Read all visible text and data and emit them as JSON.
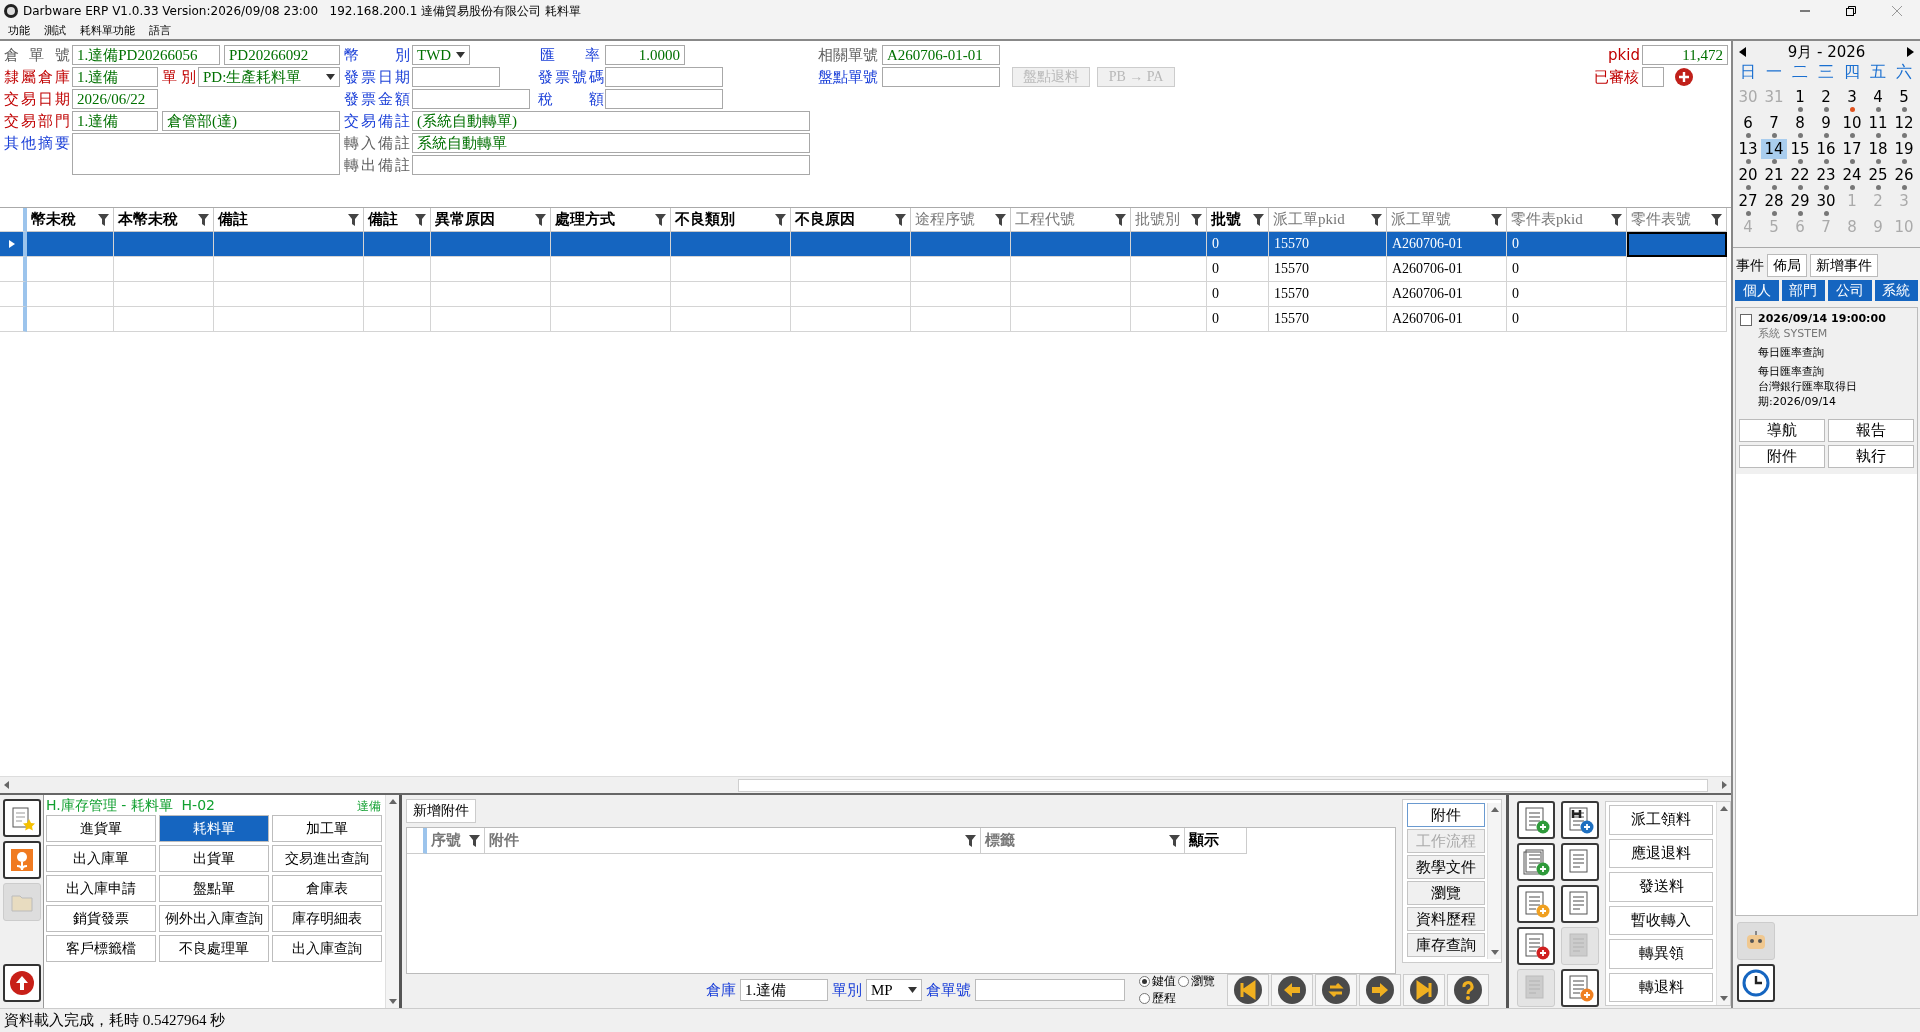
{
  "window": {
    "title": "Darbware ERP V1.0.33 Version:2026/09/08 23:00   192.168.200.1 達備貿易股份有限公司 耗料單"
  },
  "menu": [
    {
      "label": "功能"
    },
    {
      "label": "測試"
    },
    {
      "label": "耗料單功能"
    },
    {
      "label": "語言"
    }
  ],
  "form": {
    "items": [
      {
        "kind": "label",
        "text": "倉 單 號",
        "color": "#606060"
      },
      {
        "kind": "field",
        "value": "1.達備PD20266056"
      },
      {
        "kind": "field",
        "value": "PD20266092"
      },
      {
        "kind": "label",
        "text": "幣 別",
        "color": "#1a3fd8"
      },
      {
        "kind": "dropdown",
        "value": "TWD"
      },
      {
        "kind": "label",
        "text": "匯 率",
        "color": "#1a3fd8"
      },
      {
        "kind": "number",
        "value": "1.0000"
      },
      {
        "kind": "label",
        "text": "相關單號",
        "color": "#606060"
      },
      {
        "kind": "field",
        "value": "A260706-01-01"
      },
      {
        "kind": "label",
        "text": "pkid",
        "color": "#c00000"
      },
      {
        "kind": "number",
        "value": "11,472"
      },
      {
        "kind": "label",
        "text": "隸屬倉庫",
        "color": "#c00000"
      },
      {
        "kind": "field",
        "value": "1.達備"
      },
      {
        "kind": "label",
        "text": "單別",
        "color": "#c00000"
      },
      {
        "kind": "dropdown",
        "value": "PD:生產耗料單"
      },
      {
        "kind": "label",
        "text": "發票日期",
        "color": "#1a3fd8"
      },
      {
        "kind": "field"
      },
      {
        "kind": "label",
        "text": "發票號碼",
        "color": "#1a3fd8"
      },
      {
        "kind": "field"
      },
      {
        "kind": "label",
        "text": "盤點單號",
        "color": "#1a3fd8"
      },
      {
        "kind": "field"
      },
      {
        "kind": "button",
        "text": "盤點退料",
        "disabled": true
      },
      {
        "kind": "button",
        "text": "PB → PA",
        "disabled": true
      },
      {
        "kind": "label",
        "text": "已審核",
        "color": "#c00000"
      },
      {
        "kind": "checkbox",
        "checked": false
      },
      {
        "kind": "add"
      },
      {
        "kind": "label",
        "text": "交易日期",
        "color": "#c00000"
      },
      {
        "kind": "field",
        "value": "2026/06/22"
      },
      {
        "kind": "label",
        "text": "發票金額",
        "color": "#1a3fd8"
      },
      {
        "kind": "field"
      },
      {
        "kind": "label",
        "text": "稅 額",
        "color": "#1a3fd8"
      },
      {
        "kind": "field"
      },
      {
        "kind": "label",
        "text": "交易部門",
        "color": "#c00000"
      },
      {
        "kind": "field",
        "value": "1.達備"
      },
      {
        "kind": "field",
        "value": "倉管部(達)"
      },
      {
        "kind": "label",
        "text": "交易備註",
        "color": "#1a3fd8"
      },
      {
        "kind": "field",
        "value": "(系統自動轉單)"
      },
      {
        "kind": "label",
        "text": "其他摘要",
        "color": "#1a3fd8"
      },
      {
        "kind": "textarea"
      },
      {
        "kind": "label",
        "text": "轉入備註",
        "color": "#606060"
      },
      {
        "kind": "field",
        "value": "系統自動轉單"
      },
      {
        "kind": "label",
        "text": "轉出備註",
        "color": "#606060"
      },
      {
        "kind": "field"
      }
    ]
  },
  "table": {
    "columns": [
      {
        "header": "幣未稅",
        "readonly": false
      },
      {
        "header": "本幣未稅",
        "readonly": false
      },
      {
        "header": "備註",
        "readonly": false
      },
      {
        "header": "備註",
        "readonly": false
      },
      {
        "header": "異常原因",
        "readonly": false
      },
      {
        "header": "處理方式",
        "readonly": false
      },
      {
        "header": "不良類別",
        "readonly": false
      },
      {
        "header": "不良原因",
        "readonly": false
      },
      {
        "header": "途程序號",
        "readonly": true
      },
      {
        "header": "工程代號",
        "readonly": true
      },
      {
        "header": "批號別",
        "readonly": true
      },
      {
        "header": "批號",
        "readonly": false
      },
      {
        "header": "派工單pkid",
        "readonly": true
      },
      {
        "header": "派工單號",
        "readonly": true
      },
      {
        "header": "零件表pkid",
        "readonly": true
      },
      {
        "header": "零件表號",
        "readonly": true
      }
    ],
    "rows": [
      {
        "selected": true,
        "lot": "0",
        "dispatch_pkid": "15570",
        "dispatch_no": "A260706-01",
        "parts_pkid": "0"
      },
      {
        "selected": false,
        "lot": "0",
        "dispatch_pkid": "15570",
        "dispatch_no": "A260706-01",
        "parts_pkid": "0"
      },
      {
        "selected": false,
        "lot": "0",
        "dispatch_pkid": "15570",
        "dispatch_no": "A260706-01",
        "parts_pkid": "0"
      },
      {
        "selected": false,
        "lot": "0",
        "dispatch_pkid": "15570",
        "dispatch_no": "A260706-01",
        "parts_pkid": "0"
      }
    ]
  },
  "side_icons": [
    {
      "disabled": false
    },
    {
      "disabled": false
    },
    {
      "disabled": true
    },
    {
      "disabled": false
    }
  ],
  "module": {
    "title": "H.庫存管理 - 耗料單  H-02",
    "company": "達備",
    "buttons": [
      {
        "label": "進貨單",
        "selected": false
      },
      {
        "label": "耗料單",
        "selected": true
      },
      {
        "label": "加工單",
        "selected": false
      },
      {
        "label": "出入庫單",
        "selected": false
      },
      {
        "label": "出貨單",
        "selected": false
      },
      {
        "label": "交易進出查詢",
        "selected": false
      },
      {
        "label": "出入庫申請",
        "selected": false
      },
      {
        "label": "盤點單",
        "selected": false
      },
      {
        "label": "倉庫表",
        "selected": false
      },
      {
        "label": "銷貨發票",
        "selected": false
      },
      {
        "label": "例外出入庫查詢",
        "selected": false
      },
      {
        "label": "庫存明細表",
        "selected": false
      },
      {
        "label": "客戶標籤檔",
        "selected": false
      },
      {
        "label": "不良處理單",
        "selected": false
      },
      {
        "label": "出入庫查詢",
        "selected": false
      }
    ]
  },
  "attachments": {
    "add_button": "新增附件",
    "columns": [
      "序號",
      "附件",
      "標籤",
      "顯示"
    ],
    "side_buttons": [
      {
        "label": "附件",
        "selected": true,
        "disabled": false
      },
      {
        "label": "工作流程",
        "selected": false,
        "disabled": true
      },
      {
        "label": "教學文件",
        "selected": false,
        "disabled": false
      },
      {
        "label": "瀏覽",
        "selected": false,
        "disabled": false
      },
      {
        "label": "資料歷程",
        "selected": false,
        "disabled": false
      },
      {
        "label": "庫存查詢",
        "selected": false,
        "disabled": false
      }
    ]
  },
  "query": {
    "warehouse_label": "倉庫",
    "warehouse": "1.達備",
    "type_label": "單別",
    "type": "MP",
    "doc_label": "倉單號",
    "modes": [
      {
        "label": "鍵值",
        "selected": true
      },
      {
        "label": "瀏覽",
        "selected": false
      },
      {
        "label": "歷程",
        "selected": false
      }
    ]
  },
  "tool_icons": [
    {
      "disabled": false
    },
    {
      "disabled": false
    },
    {
      "disabled": false
    },
    {
      "disabled": false
    },
    {
      "disabled": false
    },
    {
      "disabled": false
    },
    {
      "disabled": false
    },
    {
      "disabled": true
    },
    {
      "disabled": true
    },
    {
      "disabled": false
    }
  ],
  "actions": [
    {
      "label": "派工領料"
    },
    {
      "label": "應退退料"
    },
    {
      "label": "發送料"
    },
    {
      "label": "暫收轉入"
    },
    {
      "label": "轉異領"
    },
    {
      "label": "轉退料"
    }
  ],
  "calendar": {
    "month": "9月 - 2026",
    "weekdays": [
      "日",
      "一",
      "二",
      "三",
      "四",
      "五",
      "六"
    ],
    "days": [
      {
        "day": "30",
        "in_month": false,
        "selected": false
      },
      {
        "day": "31",
        "in_month": false,
        "selected": false
      },
      {
        "day": "1",
        "in_month": true,
        "selected": false,
        "color": "#777777"
      },
      {
        "day": "2",
        "in_month": true,
        "selected": false,
        "color": "#777777"
      },
      {
        "day": "3",
        "in_month": true,
        "selected": false,
        "color": "#e0531f"
      },
      {
        "day": "4",
        "in_month": true,
        "selected": false,
        "color": "#777777"
      },
      {
        "day": "5",
        "in_month": true,
        "selected": false,
        "color": "#777777"
      },
      {
        "day": "6",
        "in_month": true,
        "selected": false,
        "color": "#777777"
      },
      {
        "day": "7",
        "in_month": true,
        "selected": false,
        "color": "#777777"
      },
      {
        "day": "8",
        "in_month": true,
        "selected": false,
        "color": "#777777"
      },
      {
        "day": "9",
        "in_month": true,
        "selected": false,
        "color": "#777777"
      },
      {
        "day": "10",
        "in_month": true,
        "selected": false,
        "color": "#777777"
      },
      {
        "day": "11",
        "in_month": true,
        "selected": false,
        "color": "#777777"
      },
      {
        "day": "12",
        "in_month": true,
        "selected": false,
        "color": "#777777"
      },
      {
        "day": "13",
        "in_month": true,
        "selected": false,
        "color": "#777777"
      },
      {
        "day": "14",
        "in_month": true,
        "selected": true,
        "color": "#777777"
      },
      {
        "day": "15",
        "in_month": true,
        "selected": false,
        "color": "#777777"
      },
      {
        "day": "16",
        "in_month": true,
        "selected": false,
        "color": "#777777"
      },
      {
        "day": "17",
        "in_month": true,
        "selected": false,
        "color": "#777777"
      },
      {
        "day": "18",
        "in_month": true,
        "selected": false,
        "color": "#777777"
      },
      {
        "day": "19",
        "in_month": true,
        "selected": false,
        "color": "#777777"
      },
      {
        "day": "20",
        "in_month": true,
        "selected": false,
        "color": "#777777"
      },
      {
        "day": "21",
        "in_month": true,
        "selected": false,
        "color": "#777777"
      },
      {
        "day": "22",
        "in_month": true,
        "selected": false,
        "color": "#777777"
      },
      {
        "day": "23",
        "in_month": true,
        "selected": false,
        "color": "#777777"
      },
      {
        "day": "24",
        "in_month": true,
        "selected": false,
        "color": "#777777"
      },
      {
        "day": "25",
        "in_month": true,
        "selected": false,
        "color": "#777777"
      },
      {
        "day": "26",
        "in_month": true,
        "selected": false,
        "color": "#777777"
      },
      {
        "day": "27",
        "in_month": true,
        "selected": false,
        "color": "#777777"
      },
      {
        "day": "28",
        "in_month": true,
        "selected": false,
        "color": "#777777"
      },
      {
        "day": "29",
        "in_month": true,
        "selected": false,
        "color": "#777777"
      },
      {
        "day": "30",
        "in_month": true,
        "selected": false,
        "color": "#777777"
      },
      {
        "day": "1",
        "in_month": false,
        "selected": false
      },
      {
        "day": "2",
        "in_month": false,
        "selected": false
      },
      {
        "day": "3",
        "in_month": false,
        "selected": false
      },
      {
        "day": "4",
        "in_month": false,
        "selected": false
      },
      {
        "day": "5",
        "in_month": false,
        "selected": false
      },
      {
        "day": "6",
        "in_month": false,
        "selected": false
      },
      {
        "day": "7",
        "in_month": false,
        "selected": false
      },
      {
        "day": "8",
        "in_month": false,
        "selected": false
      },
      {
        "day": "9",
        "in_month": false,
        "selected": false
      },
      {
        "day": "10",
        "in_month": false,
        "selected": false
      }
    ]
  },
  "events": {
    "label": "事件",
    "buttons": [
      {
        "label": "佈局"
      },
      {
        "label": "新增事件"
      }
    ],
    "tabs": [
      {
        "label": "個人",
        "on": true
      },
      {
        "label": "部門",
        "on": true
      },
      {
        "label": "公司",
        "on": true
      },
      {
        "label": "系統",
        "on": true
      }
    ],
    "items": [
      {
        "checked": false,
        "time": "2026/09/14 19:00:00",
        "source": "系統  SYSTEM",
        "title": "每日匯率查詢",
        "detail": [
          "每日匯率查詢",
          "台灣銀行匯率取得日期:2026/09/14"
        ]
      }
    ],
    "actions": [
      {
        "label": "導航"
      },
      {
        "label": "報告"
      },
      {
        "label": "附件"
      },
      {
        "label": "執行"
      }
    ]
  },
  "status_bar": "資料載入完成，耗時 0.5427964 秒"
}
